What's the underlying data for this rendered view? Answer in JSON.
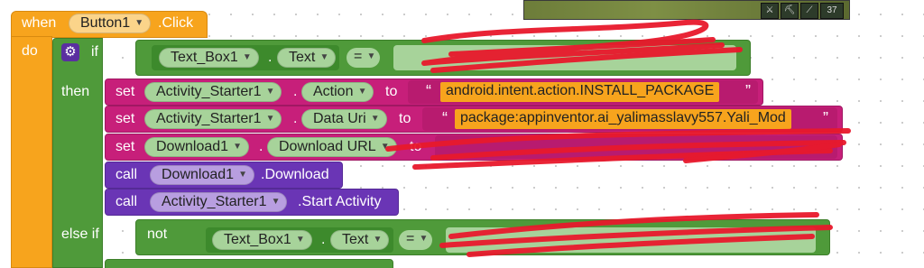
{
  "event": {
    "when": "when",
    "component": "Button1",
    "event": ".Click",
    "do": "do"
  },
  "if_block": {
    "if": "if",
    "then": "then",
    "else_if": "else if"
  },
  "condition": {
    "component": "Text_Box1",
    "property": "Text",
    "operator": "="
  },
  "statements": [
    {
      "kind": "set",
      "keyword": "set",
      "component": "Activity_Starter1",
      "property": "Action",
      "to": "to",
      "value": "android.intent.action.INSTALL_PACKAGE"
    },
    {
      "kind": "set",
      "keyword": "set",
      "component": "Activity_Starter1",
      "property": "Data Uri",
      "to": "to",
      "value": "package:appinventor.ai_yalimasslavy557.Yali_Mod"
    },
    {
      "kind": "set",
      "keyword": "set",
      "component": "Download1",
      "property": "Download URL",
      "to": "to",
      "value": ""
    },
    {
      "kind": "call",
      "keyword": "call",
      "component": "Download1",
      "method": ".Download"
    },
    {
      "kind": "call",
      "keyword": "call",
      "component": "Activity_Starter1",
      "method": ".Start Activity"
    }
  ],
  "else_condition": {
    "not": "not",
    "component": "Text_Box1",
    "property": "Text",
    "operator": "="
  },
  "hud": {
    "count": "37"
  },
  "colors": {
    "event": "#f7a41d",
    "logic": "#4f9a3a",
    "setter": "#c71f7a",
    "call": "#6a35b5",
    "redaction": "#e8192c"
  }
}
